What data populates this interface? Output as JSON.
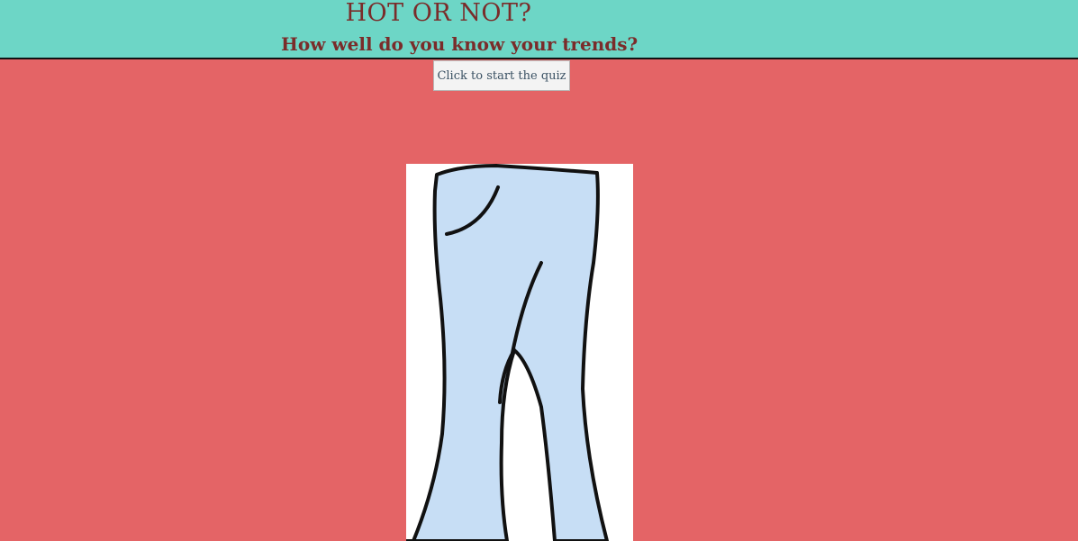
{
  "header": {
    "title": "HOT OR NOT?",
    "subtitle": "How well do you know your trends?"
  },
  "quiz": {
    "start_label": "Click to start the quiz"
  },
  "colors": {
    "background": "#e46466",
    "header": "#6dd6c6",
    "title_text": "#7a2c2a",
    "pants_fill": "#c7def5"
  },
  "image": {
    "icon": "flared-pants-icon"
  }
}
